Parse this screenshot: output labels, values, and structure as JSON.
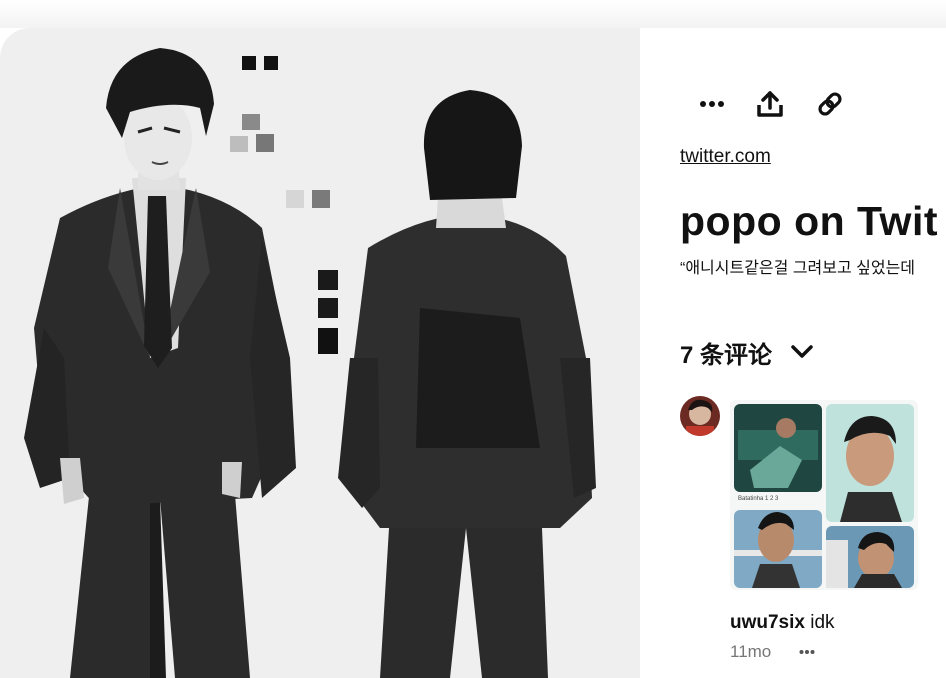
{
  "pin": {
    "source_label": "twitter.com",
    "title": "popo on Twit",
    "description": "“애니시트같은걸 그려보고 싶었는데",
    "image_icon": "anime-character-sheet-image"
  },
  "actions": {
    "more_icon": "more-icon",
    "share_icon": "share-icon",
    "link_icon": "link-icon"
  },
  "comments": {
    "count_label": "7 条评论",
    "toggle_icon": "chevron-down-icon",
    "items": [
      {
        "username": "uwu7six",
        "text": "idk",
        "age": "11mo",
        "attachment_caption": "Batatinha 1 2 3",
        "more_icon": "more-icon"
      }
    ]
  },
  "colors": {
    "page_background": "#ffffff",
    "image_background": "#efefef",
    "suit": "#2b2b2b",
    "text": "#111111",
    "muted_text": "#767676"
  }
}
